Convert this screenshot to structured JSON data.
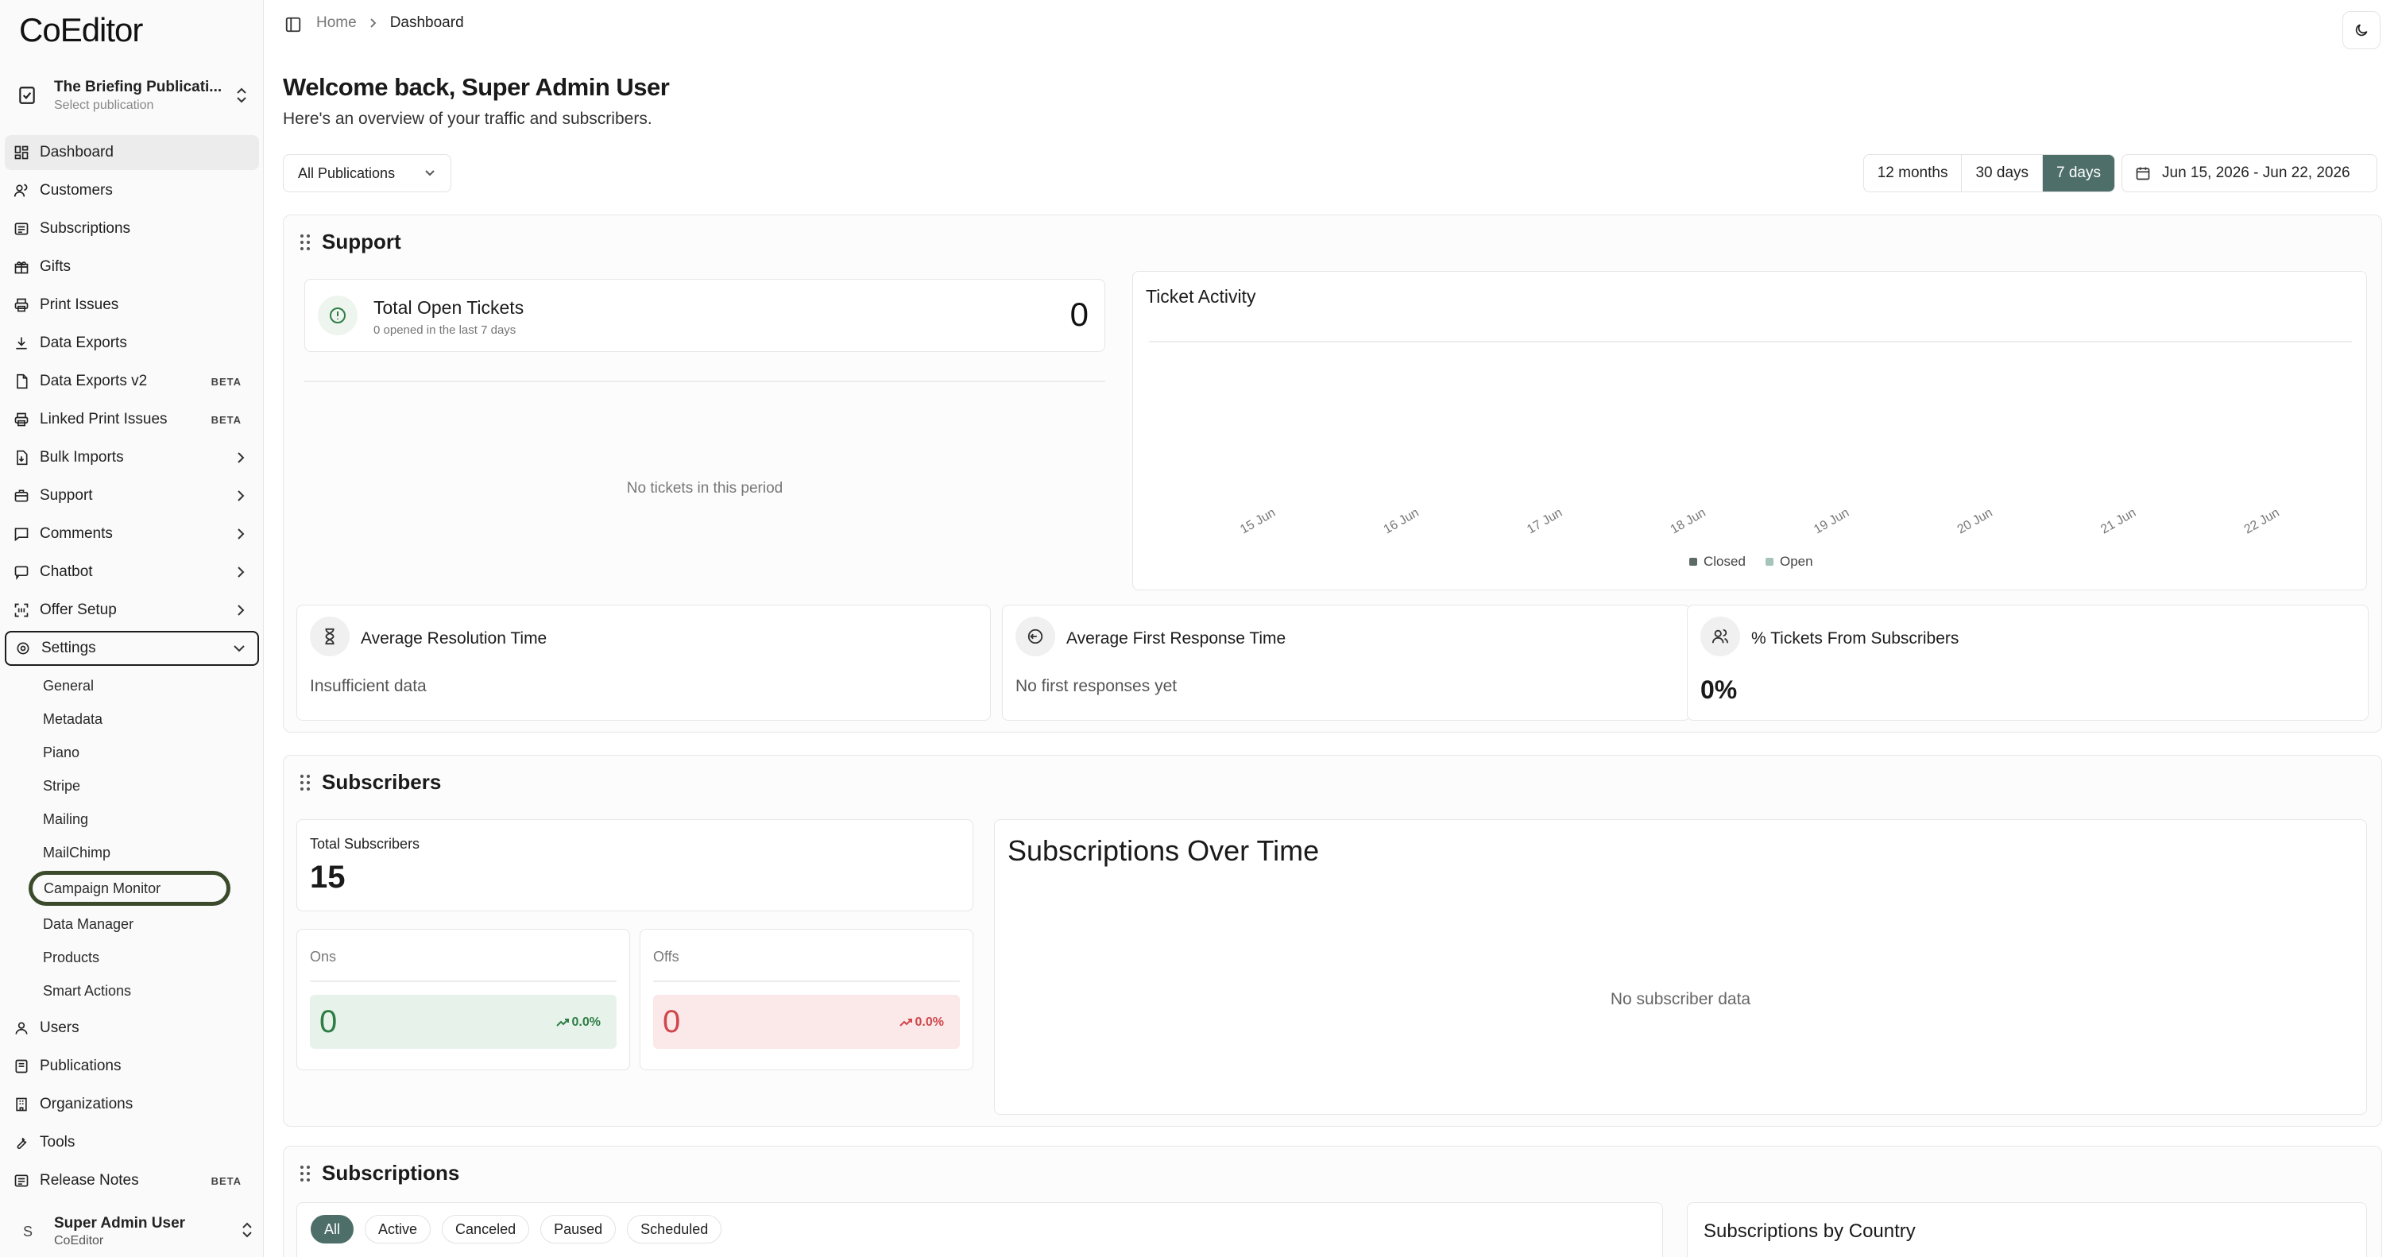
{
  "app": {
    "logo": "CoEditor"
  },
  "publication_switcher": {
    "name": "The Briefing Publicati...",
    "subtitle": "Select publication"
  },
  "nav": {
    "items": [
      {
        "label": "Dashboard"
      },
      {
        "label": "Customers"
      },
      {
        "label": "Subscriptions"
      },
      {
        "label": "Gifts"
      },
      {
        "label": "Print Issues"
      },
      {
        "label": "Data Exports"
      },
      {
        "label": "Data Exports v2",
        "badge": "BETA"
      },
      {
        "label": "Linked Print Issues",
        "badge": "BETA"
      },
      {
        "label": "Bulk Imports"
      },
      {
        "label": "Support"
      },
      {
        "label": "Comments"
      },
      {
        "label": "Chatbot"
      },
      {
        "label": "Offer Setup"
      },
      {
        "label": "Settings"
      }
    ],
    "settings_sub": [
      "General",
      "Metadata",
      "Piano",
      "Stripe",
      "Mailing",
      "MailChimp",
      "Campaign Monitor",
      "Data Manager",
      "Products",
      "Smart Actions"
    ],
    "bottom_items": [
      {
        "label": "Users"
      },
      {
        "label": "Publications"
      },
      {
        "label": "Organizations"
      },
      {
        "label": "Tools"
      },
      {
        "label": "Release Notes",
        "badge": "BETA"
      }
    ]
  },
  "user": {
    "initial": "S",
    "name": "Super Admin User",
    "org": "CoEditor"
  },
  "breadcrumb": {
    "home": "Home",
    "current": "Dashboard"
  },
  "page": {
    "welcome": "Welcome back, Super Admin User",
    "subtitle": "Here's an overview of your traffic and subscribers."
  },
  "filters": {
    "publication": "All Publications",
    "ranges": [
      "12 months",
      "30 days",
      "7 days"
    ],
    "active_range": "7 days",
    "date_range": "Jun 15, 2026 - Jun 22, 2026"
  },
  "support": {
    "title": "Support",
    "open_tickets": {
      "title": "Total Open Tickets",
      "subtitle": "0 opened in the last 7 days",
      "value": "0"
    },
    "no_tickets": "No tickets in this period",
    "ticket_activity": {
      "title": "Ticket Activity",
      "x_labels": [
        "15 Jun",
        "16 Jun",
        "17 Jun",
        "18 Jun",
        "19 Jun",
        "20 Jun",
        "21 Jun",
        "22 Jun"
      ],
      "legend": [
        "Closed",
        "Open"
      ]
    },
    "avg_resolution": {
      "title": "Average Resolution Time",
      "value": "Insufficient data"
    },
    "avg_first_response": {
      "title": "Average First Response Time",
      "value": "No first responses yet"
    },
    "pct_from_subscribers": {
      "title": "% Tickets From Subscribers",
      "value": "0%"
    }
  },
  "subscribers": {
    "title": "Subscribers",
    "total": {
      "label": "Total Subscribers",
      "value": "15"
    },
    "ons": {
      "label": "Ons",
      "value": "0",
      "change": "0.0%"
    },
    "offs": {
      "label": "Offs",
      "value": "0",
      "change": "0.0%"
    },
    "over_time": {
      "title": "Subscriptions Over Time",
      "empty": "No subscriber data"
    }
  },
  "subscriptions": {
    "title": "Subscriptions",
    "tabs": [
      "All",
      "Active",
      "Canceled",
      "Paused",
      "Scheduled"
    ],
    "active_tab": "All",
    "by_country": {
      "title": "Subscriptions by Country"
    }
  },
  "colors": {
    "accent": "#4e6e69",
    "ons": "#2f7d45",
    "offs": "#d0474c",
    "legend_closed": "#5c6b66",
    "legend_open": "#a7c4bc"
  },
  "chart_data": {
    "type": "bar",
    "title": "Ticket Activity",
    "categories": [
      "15 Jun",
      "16 Jun",
      "17 Jun",
      "18 Jun",
      "19 Jun",
      "20 Jun",
      "21 Jun",
      "22 Jun"
    ],
    "series": [
      {
        "name": "Closed",
        "values": [
          0,
          0,
          0,
          0,
          0,
          0,
          0,
          0
        ]
      },
      {
        "name": "Open",
        "values": [
          0,
          0,
          0,
          0,
          0,
          0,
          0,
          0
        ]
      }
    ],
    "legend": "bottom-center"
  }
}
